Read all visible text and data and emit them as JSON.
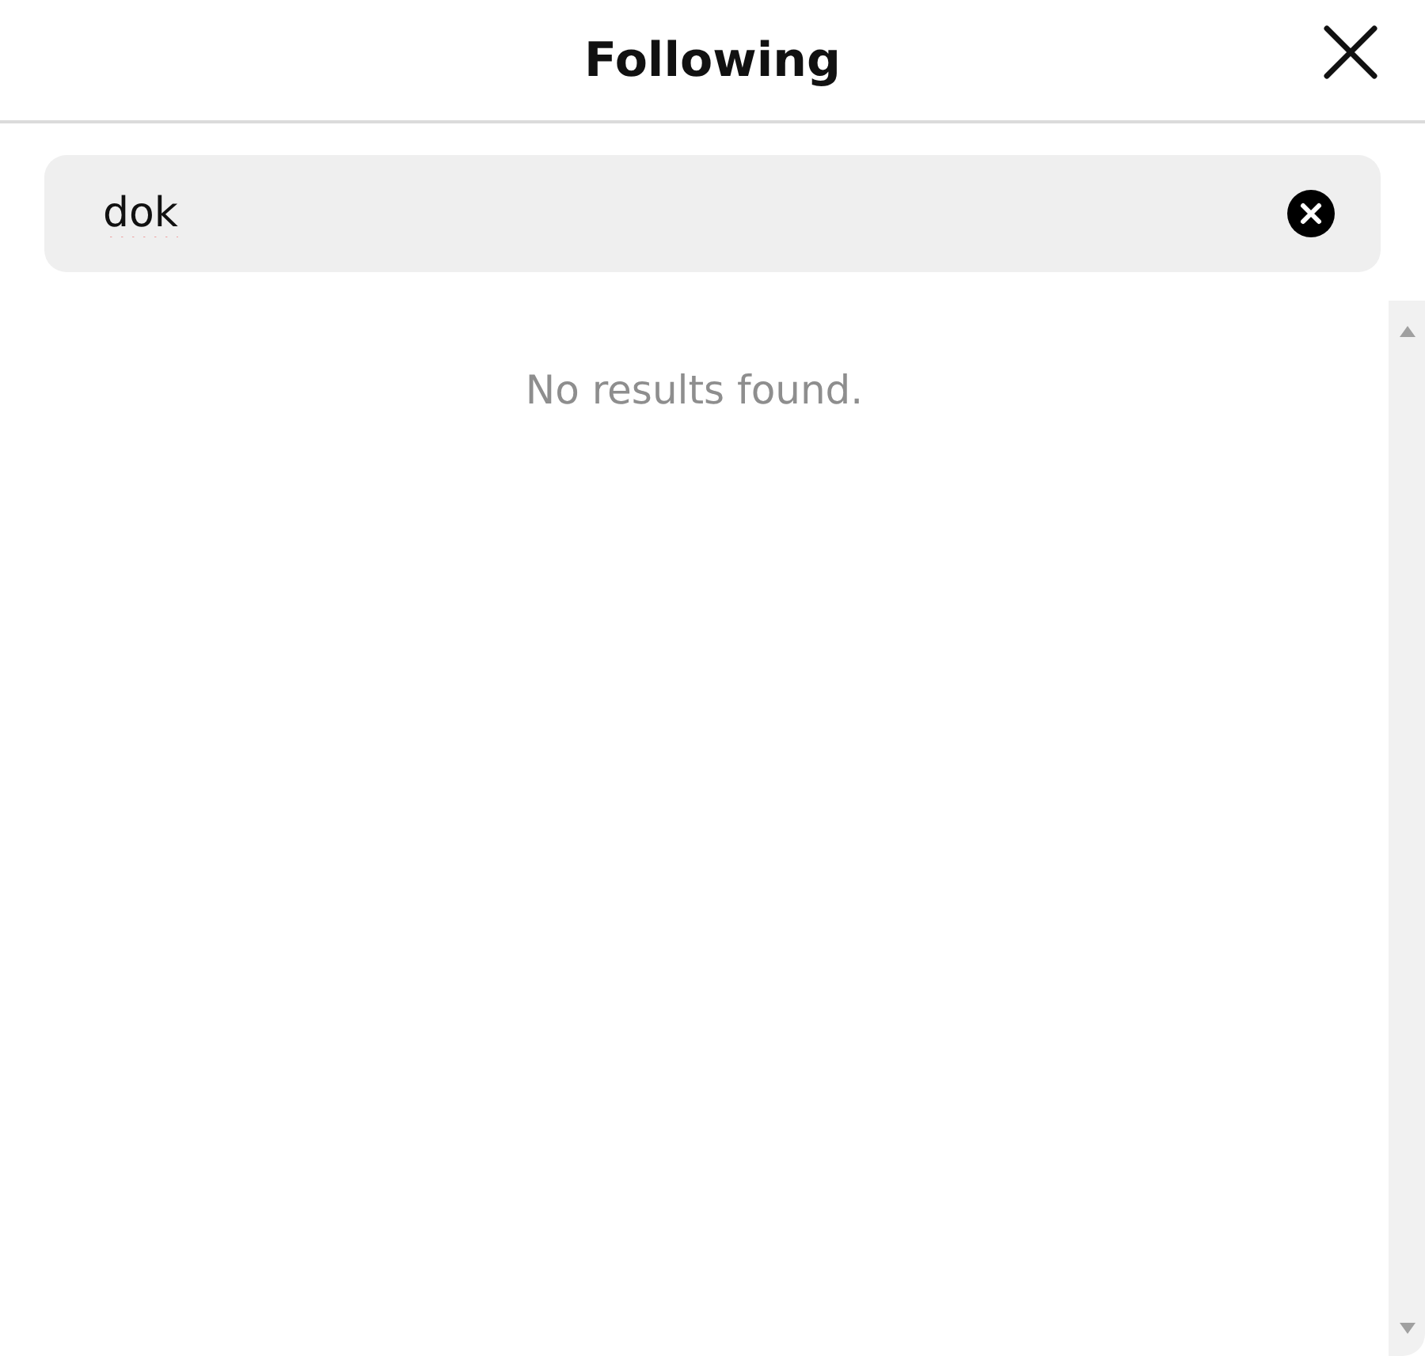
{
  "dialog": {
    "title": "Following"
  },
  "search": {
    "value": "dok"
  },
  "results": {
    "message": "No results found."
  }
}
